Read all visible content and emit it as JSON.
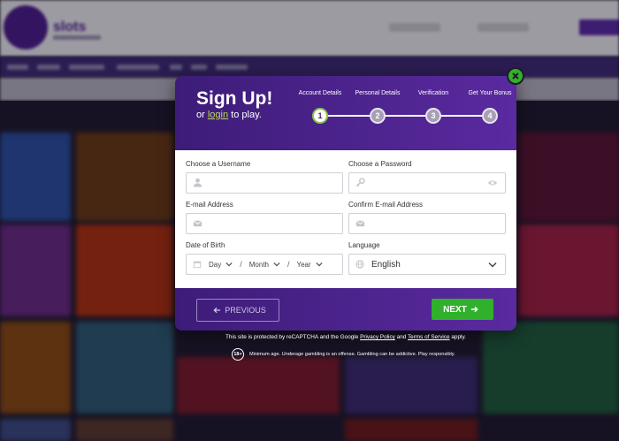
{
  "background_site": {
    "logo_text": "slots"
  },
  "signup": {
    "title": "Sign Up!",
    "subtitle_prefix": "or",
    "login_link": "login",
    "subtitle_suffix": "to play.",
    "steps": [
      {
        "label": "Account Details",
        "number": "1",
        "active": true
      },
      {
        "label": "Personal Details",
        "number": "2",
        "active": false
      },
      {
        "label": "Verification",
        "number": "3",
        "active": false
      },
      {
        "label": "Get Your Bonus",
        "number": "4",
        "active": false
      }
    ],
    "fields": {
      "username": {
        "label": "Choose a Username",
        "value": ""
      },
      "password": {
        "label": "Choose a Password",
        "value": ""
      },
      "email": {
        "label": "E-mail Address",
        "value": ""
      },
      "confirm_email": {
        "label": "Confirm E-mail Address",
        "value": ""
      },
      "dob": {
        "label": "Date of Birth",
        "day": "Day",
        "month": "Month",
        "year": "Year",
        "separator": "/"
      },
      "language": {
        "label": "Language",
        "value": "English"
      }
    },
    "buttons": {
      "previous": "PREVIOUS",
      "next": "NEXT"
    }
  },
  "legal": {
    "recaptcha_prefix": "This site is protected by reCAPTCHA and the Google",
    "privacy_link": "Privacy Policy",
    "and": "and",
    "terms_link": "Terms of Service",
    "recaptcha_suffix": "apply.",
    "age_badge": "18+",
    "age_notice": "Minimum age. Underage gambling is an offense. Gambling can be addictive. Play responsibly."
  },
  "colors": {
    "brand_purple": "#4b1d8a",
    "accent_green": "#31b02c",
    "login_link": "#b9d95a"
  }
}
